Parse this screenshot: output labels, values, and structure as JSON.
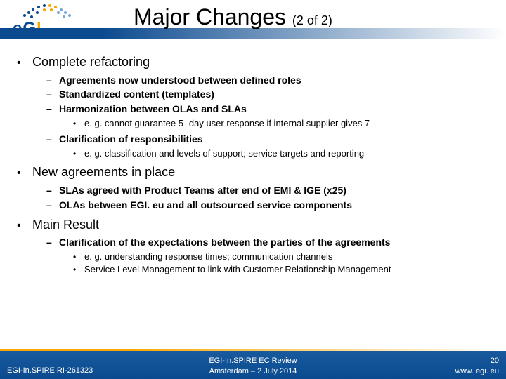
{
  "logo": {
    "text_e": "e",
    "text_g": "G",
    "text_i": "I"
  },
  "title": "Major Changes ",
  "subtitle": "(2 of 2)",
  "bullets": [
    {
      "text": "Complete refactoring",
      "children": [
        {
          "text": "Agreements now understood between defined roles"
        },
        {
          "text": "Standardized content (templates)"
        },
        {
          "text": "Harmonization between OLAs and SLAs",
          "children": [
            {
              "text": "e. g. cannot guarantee 5 -day user response if internal supplier gives 7"
            }
          ]
        },
        {
          "text": "Clarification of responsibilities",
          "children": [
            {
              "text": "e. g. classification and levels of support; service targets and reporting"
            }
          ]
        }
      ]
    },
    {
      "text": "New agreements in place",
      "children": [
        {
          "text": "SLAs agreed with Product Teams after end of EMI & IGE (x25)"
        },
        {
          "text": "OLAs between EGI. eu and all outsourced service components"
        }
      ]
    },
    {
      "text": "Main Result",
      "children": [
        {
          "text": "Clarification of the expectations between the parties of the agreements",
          "children": [
            {
              "text": "e. g. understanding response times; communication channels"
            },
            {
              "text": "Service Level Management to link with Customer Relationship Management"
            }
          ]
        }
      ]
    }
  ],
  "footer": {
    "left": "EGI-In.SPIRE RI-261323",
    "center_line1": "EGI-In.SPIRE EC Review",
    "center_line2": "Amsterdam – 2 July 2014",
    "right_page": "20",
    "right_url": "www. egi. eu"
  }
}
